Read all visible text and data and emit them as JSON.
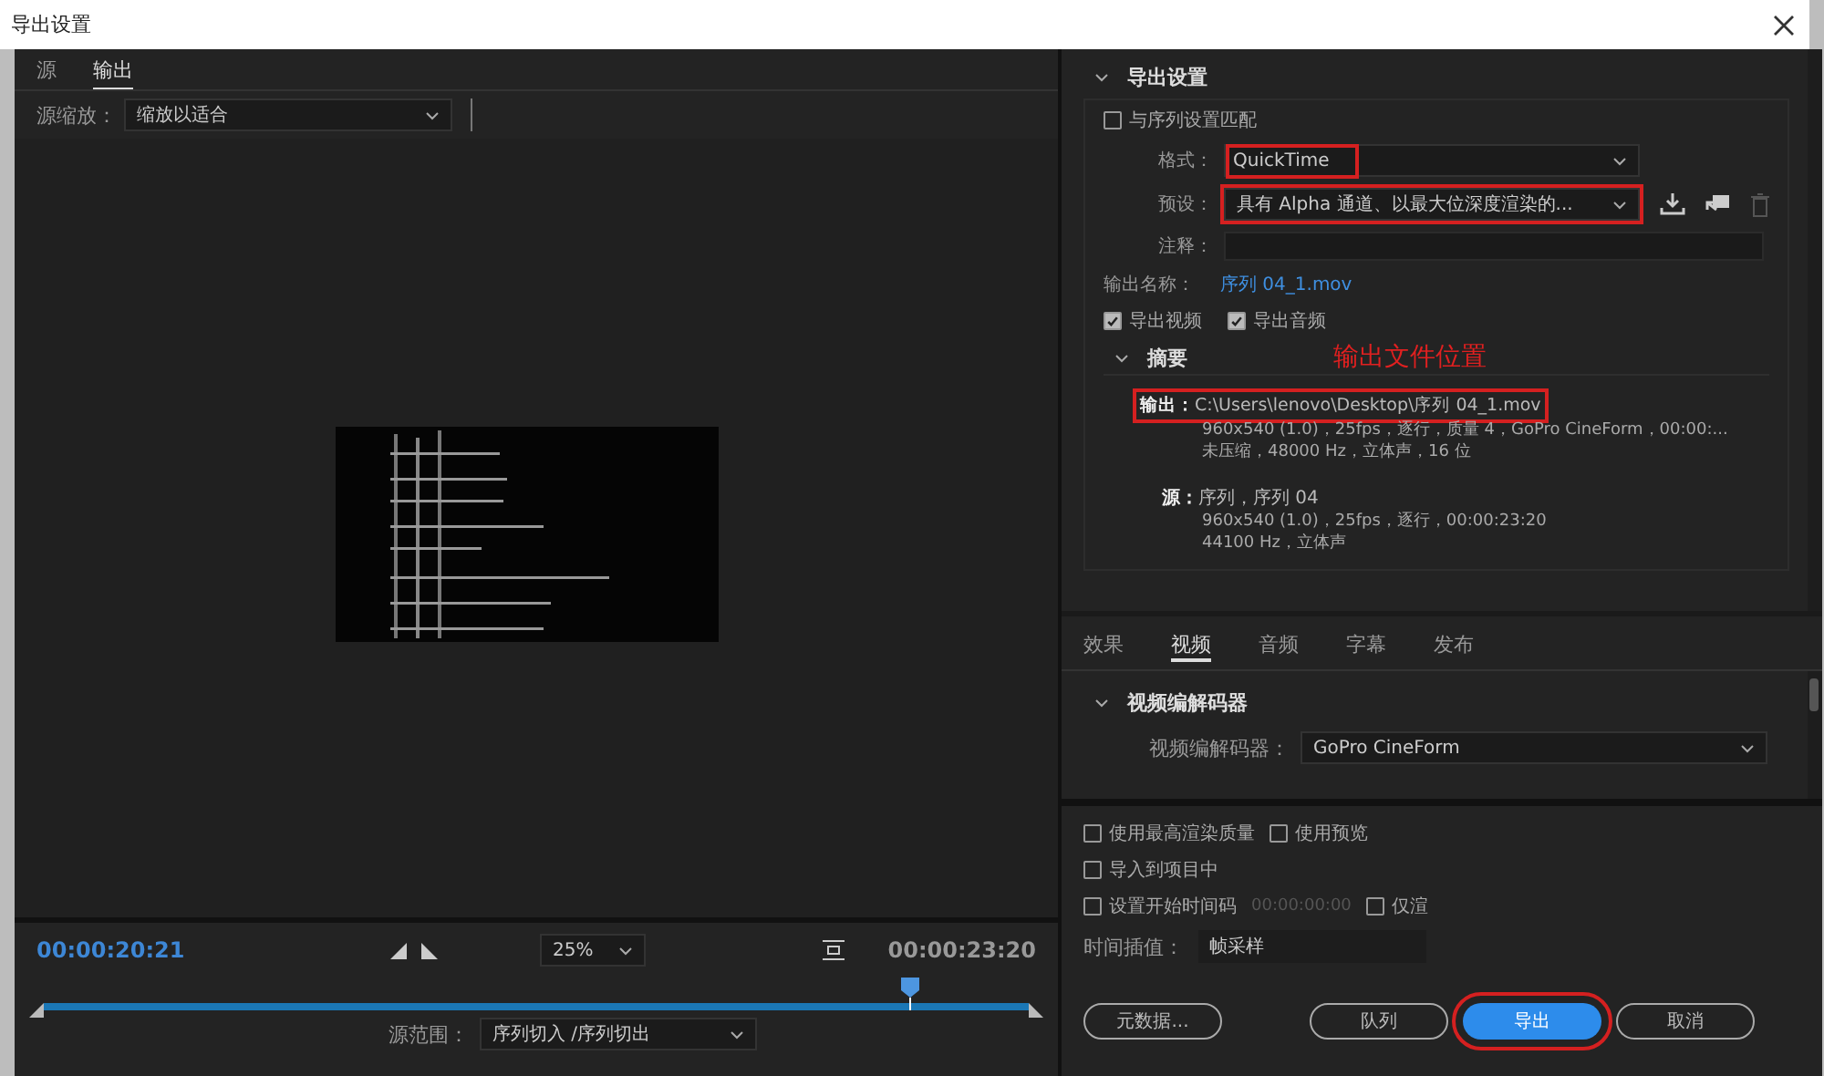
{
  "window": {
    "title": "导出设置"
  },
  "left_panel": {
    "tabs": [
      {
        "label": "源",
        "selected": false
      },
      {
        "label": "输出",
        "selected": true
      }
    ],
    "source_scaling": {
      "label": "源缩放：",
      "value": "缩放以适合"
    },
    "timeline": {
      "current_time": "00:00:20:21",
      "zoom": "25%",
      "duration": "00:00:23:20",
      "level": 0.88
    },
    "source_range": {
      "label": "源范围：",
      "value": "序列切入 /序列切出"
    }
  },
  "export_settings": {
    "title": "导出设置",
    "expanded": true,
    "match_sequence": {
      "label": "与序列设置匹配",
      "checked": false
    },
    "format": {
      "label": "格式：",
      "value": "QuickTime",
      "highlighted": true
    },
    "preset": {
      "label": "预设：",
      "value": "具有 Alpha 通道、以最大位深度渲染的...",
      "highlighted": true
    },
    "comments": {
      "label": "注释："
    },
    "output_name": {
      "label": "输出名称：",
      "value": "序列 04_1.mov"
    },
    "exports": [
      {
        "label": "导出视频",
        "checked": true
      },
      {
        "label": "导出音频",
        "checked": true
      }
    ],
    "summary": {
      "title": "摘要",
      "expanded": true,
      "annotation": "输出文件位置",
      "output_label": "输出：",
      "output_path": "C:\\Users\\lenovo\\Desktop\\序列 04_1.mov",
      "output_highlighted": true,
      "output_lines": [
        "960x540 (1.0)，25fps，逐行，质量 4，GoPro CineForm，00:00:...",
        "未压缩，48000 Hz，立体声，16 位"
      ],
      "source_label": "源：",
      "source_name": "序列，序列 04",
      "source_lines": [
        "960x540 (1.0)，25fps，逐行，00:00:23:20",
        "44100 Hz，立体声"
      ]
    }
  },
  "settings_tabs": [
    {
      "label": "效果",
      "selected": false
    },
    {
      "label": "视频",
      "selected": true
    },
    {
      "label": "音频",
      "selected": false
    },
    {
      "label": "字幕",
      "selected": false
    },
    {
      "label": "发布",
      "selected": false
    }
  ],
  "video_codec": {
    "title": "视频编解码器",
    "expanded": true,
    "label": "视频编解码器：",
    "value": "GoPro CineForm"
  },
  "options": [
    [
      {
        "label": "使用最高渲染质量",
        "checked": false
      },
      {
        "label": "使用预览",
        "checked": false
      }
    ],
    [
      {
        "label": "导入到项目中",
        "checked": false
      }
    ],
    [
      {
        "label": "设置开始时间码",
        "checked": false,
        "timecode": "00:00:00:00"
      },
      {
        "label": "仅渲",
        "checked": false
      }
    ]
  ],
  "time_interpolation": {
    "label": "时间插值：",
    "value": "帧采样"
  },
  "buttons": [
    {
      "label": "元数据...",
      "kind": "secondary",
      "highlighted": false
    },
    {
      "label": "队列",
      "kind": "secondary",
      "highlighted": false
    },
    {
      "label": "导出",
      "kind": "primary",
      "highlighted": true
    },
    {
      "label": "取消",
      "kind": "secondary",
      "highlighted": false
    }
  ]
}
